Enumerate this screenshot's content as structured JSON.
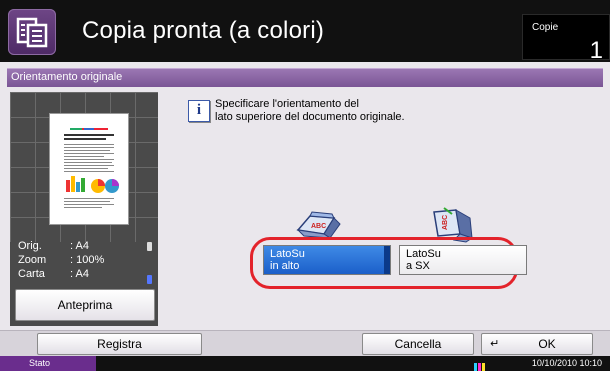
{
  "header": {
    "title": "Copia pronta (a colori)",
    "copies_label": "Copie",
    "copies_value": "1"
  },
  "section": {
    "title": "Orientamento originale"
  },
  "preview": {
    "info": [
      {
        "key": "Orig.",
        "value": ": A4"
      },
      {
        "key": "Zoom",
        "value": ": 100%"
      },
      {
        "key": "Carta",
        "value": ": A4"
      }
    ],
    "preview_button": "Anteprima"
  },
  "message": {
    "line1": "Specificare l'orientamento del",
    "line2": "lato superiore del documento originale."
  },
  "options": {
    "top": {
      "line1": "LatoSu",
      "line2": "in alto",
      "selected": true
    },
    "left": {
      "line1": "LatoSu",
      "line2": "a SX",
      "selected": false
    }
  },
  "footer": {
    "register": "Registra",
    "cancel": "Cancella",
    "ok": "OK"
  },
  "status": {
    "label": "Stato",
    "datetime": "10/10/2010  10:10"
  },
  "colors": {
    "header": "#111111",
    "section_bar": "#7a5595",
    "selected_option": "#1b5fc9",
    "highlight": "#e3232b",
    "status_left": "#6a2d8d"
  }
}
